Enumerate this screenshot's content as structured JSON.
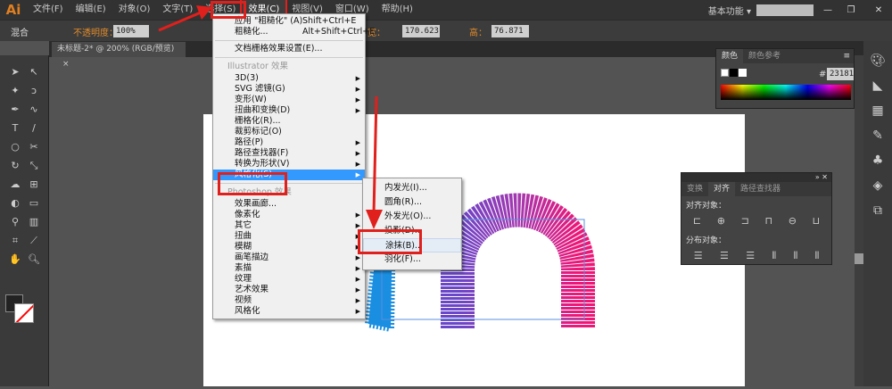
{
  "app": {
    "logo": "Ai",
    "workspace": "基本功能 ▾"
  },
  "menubar": [
    "文件(F)",
    "编辑(E)",
    "对象(O)",
    "文字(T)",
    "选择(S)",
    "效果(C)",
    "视图(V)",
    "窗口(W)",
    "帮助(H)"
  ],
  "control": {
    "mode": "混合",
    "opacity_label": "不透明度：",
    "opacity": "100%",
    "width_label": "宽：",
    "width": "170.623",
    "height_label": "高：",
    "height": "76.871 px"
  },
  "document_tab": "未标题-2* @ 200% (RGB/预览)",
  "effect_menu": {
    "top": [
      {
        "label": "应用 \"粗糙化\" (A)",
        "shortcut": "Shift+Ctrl+E"
      },
      {
        "label": "粗糙化...",
        "shortcut": "Alt+Shift+Ctrl+E"
      }
    ],
    "doc_raster": "文档栅格效果设置(E)...",
    "illustrator_header": "Illustrator 效果",
    "illustrator_items": [
      "3D(3)",
      "SVG 滤镜(G)",
      "变形(W)",
      "扭曲和变换(D)",
      "栅格化(R)...",
      "裁剪标记(O)",
      "路径(P)",
      "路径查找器(F)",
      "转换为形状(V)",
      "风格化(S)"
    ],
    "photoshop_header": "Photoshop 效果",
    "photoshop_items": [
      "效果画廊...",
      "像素化",
      "其它",
      "扭曲",
      "模糊",
      "画笔描边",
      "素描",
      "纹理",
      "艺术效果",
      "视频",
      "风格化"
    ]
  },
  "stylize_submenu": [
    "内发光(I)...",
    "圆角(R)...",
    "外发光(O)...",
    "投影(D)...",
    "涂抹(B)...",
    "羽化(F)..."
  ],
  "color_panel": {
    "tabs": [
      "颜色",
      "颜色参考"
    ],
    "hex_label": "#",
    "hex": "231815"
  },
  "align_panel": {
    "tabs": [
      "变换",
      "对齐",
      "路径查找器"
    ],
    "align_objects": "对齐对象：",
    "distribute_objects": "分布对象："
  },
  "colors": {
    "highlight": "#3399ff",
    "annotation": "#e0201c",
    "shape_blue": "#1a8ee0",
    "shape_purple": "#7b3fc0",
    "shape_pink": "#e8177a"
  }
}
